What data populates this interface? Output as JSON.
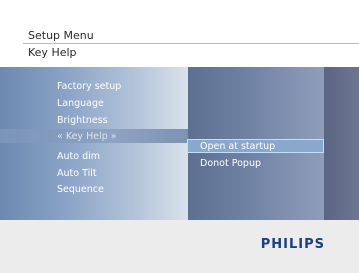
{
  "header": {
    "menu_title": "Setup Menu",
    "subtitle": "Key Help"
  },
  "menu": {
    "items": [
      {
        "label": "Factory setup"
      },
      {
        "label": "Language"
      },
      {
        "label": "Brightness"
      },
      {
        "label": "« Key Help »",
        "selected": true
      },
      {
        "label": "Auto dim"
      },
      {
        "label": "Auto Tilt"
      },
      {
        "label": "Sequence"
      }
    ]
  },
  "options": {
    "items": [
      {
        "label": "Open at startup",
        "selected": true
      },
      {
        "label": "Donot Popup"
      }
    ]
  },
  "footer": {
    "brand": "PHILIPS"
  },
  "colors": {
    "brand": "#1a3e8a",
    "panel": "#8fa6c4",
    "selection_border": "#bfe0ff"
  }
}
